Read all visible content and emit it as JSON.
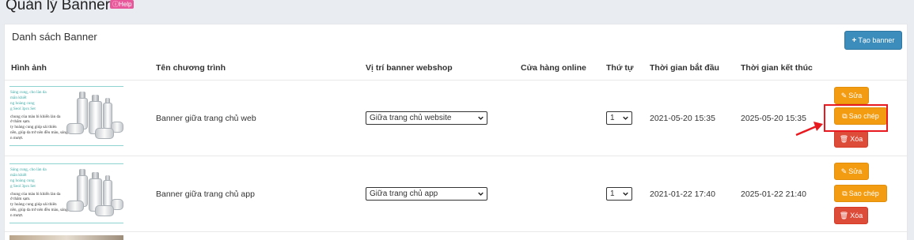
{
  "page": {
    "title": "Quản lý Banner",
    "help_label": "Help"
  },
  "panel": {
    "title": "Danh sách Banner",
    "create_button": "Tạo banner"
  },
  "table": {
    "headers": [
      "Hình ảnh",
      "Tên chương trình",
      "Vị trí banner webshop",
      "Cửa hàng online",
      "Thứ tự",
      "Thời gian bắt đầu",
      "Thời gian kết thúc"
    ]
  },
  "thumbnail_text": {
    "line1": "Sáng cung, cho làn da",
    "line2": "mãn khiết",
    "line3": "ng hoàng cung",
    "line4": "g Seol 3pcs Set",
    "line5": "chung của màu bì khiến làn da",
    "line6": "ở thâm sạm.",
    "line7": "ty hoàng cung giúp sải thiên",
    "line8": "nền, giúp da trở nên đều màu, sáng",
    "line9": "n mượt."
  },
  "rows": [
    {
      "name": "Banner giữa trang chủ web",
      "position": "Giữa trang chủ website",
      "store": "",
      "order": "1",
      "start": "2021-05-20 15:35",
      "end": "2025-05-20 15:35",
      "edit": "Sửa",
      "copy": "Sao chép",
      "delete": "Xóa"
    },
    {
      "name": "Banner giữa trang chủ app",
      "position": "Giữa trang chủ app",
      "store": "",
      "order": "1",
      "start": "2021-01-22 17:40",
      "end": "2025-01-22 21:40",
      "edit": "Sửa",
      "copy": "Sao chép",
      "delete": "Xóa"
    }
  ],
  "colors": {
    "primary": "#3c8dbc",
    "warning": "#f39c12",
    "danger": "#dd4b39",
    "help": "#e8579a",
    "annotation": "#e8191f"
  }
}
